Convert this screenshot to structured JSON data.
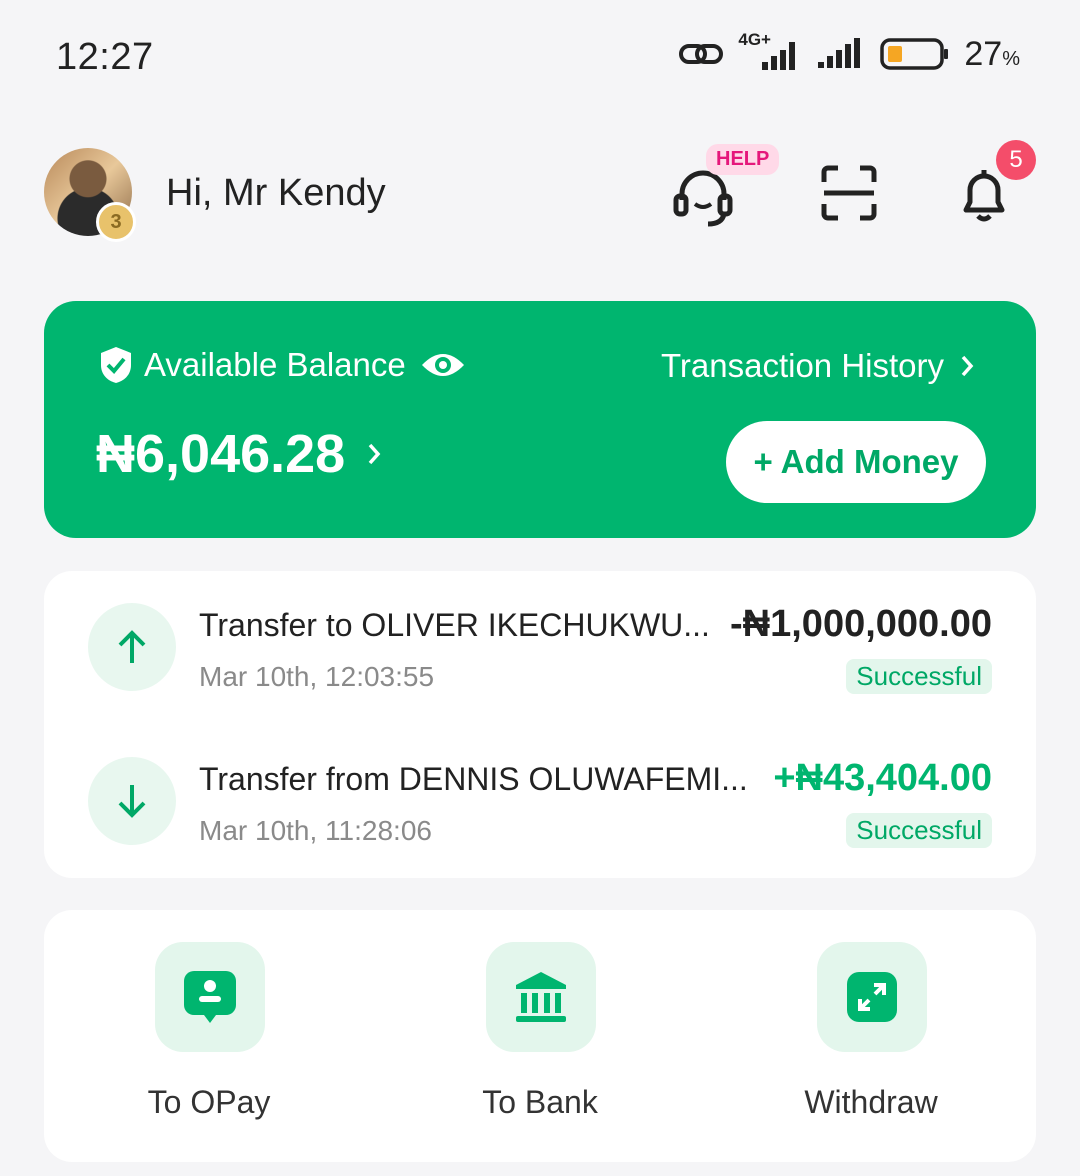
{
  "status_bar": {
    "time": "12:27",
    "network": "4G+",
    "battery_percent": "27",
    "battery_unit": "%"
  },
  "header": {
    "greeting": "Hi, Mr Kendy",
    "avatar_level": "3",
    "help_tag": "HELP",
    "notification_count": "5"
  },
  "balance": {
    "label": "Available Balance",
    "history_link": "Transaction History",
    "amount": "₦6,046.28",
    "add_money_label": "+ Add Money"
  },
  "transactions": [
    {
      "title": "Transfer to OLIVER IKECHUKWU...",
      "date": "Mar 10th, 12:03:55",
      "amount": "-₦1,000,000.00",
      "status": "Successful",
      "direction": "out"
    },
    {
      "title": "Transfer from DENNIS OLUWAFEMI...",
      "date": "Mar 10th, 11:28:06",
      "amount": "+₦43,404.00",
      "status": "Successful",
      "direction": "in"
    }
  ],
  "actions": [
    {
      "label": "To OPay",
      "icon": "opay-user-icon"
    },
    {
      "label": "To Bank",
      "icon": "bank-icon"
    },
    {
      "label": "Withdraw",
      "icon": "withdraw-icon"
    }
  ],
  "colors": {
    "brand_green": "#00b56f",
    "badge_red": "#f44d6a",
    "help_pink": "#e5177b"
  }
}
